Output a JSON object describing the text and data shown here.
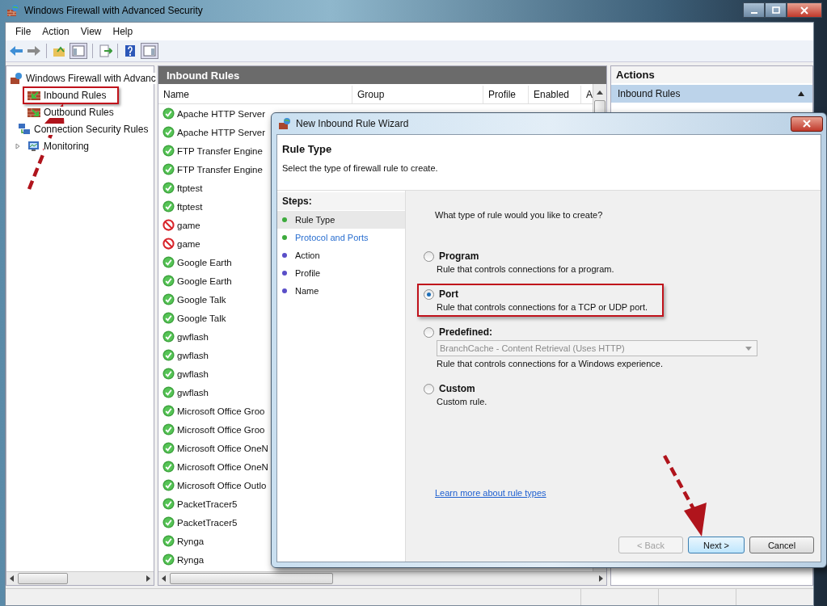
{
  "window": {
    "title": "Windows Firewall with Advanced Security"
  },
  "menu": [
    "File",
    "Action",
    "View",
    "Help"
  ],
  "tree": {
    "root": "Windows Firewall with Advanc",
    "items": [
      {
        "label": "Inbound Rules",
        "kind": "inbound",
        "expandable": false,
        "highlighted": true
      },
      {
        "label": "Outbound Rules",
        "kind": "outbound",
        "expandable": false,
        "highlighted": false
      },
      {
        "label": "Connection Security Rules",
        "kind": "security",
        "expandable": false,
        "highlighted": false
      },
      {
        "label": "Monitoring",
        "kind": "monitor",
        "expandable": true,
        "highlighted": false
      }
    ]
  },
  "rules": {
    "title": "Inbound Rules",
    "columns": [
      "Name",
      "Group",
      "Profile",
      "Enabled",
      "A"
    ],
    "rows": [
      {
        "name": "Apache HTTP Server",
        "kind": "allow"
      },
      {
        "name": "Apache HTTP Server",
        "kind": "allow"
      },
      {
        "name": "FTP Transfer Engine",
        "kind": "allow"
      },
      {
        "name": "FTP Transfer Engine",
        "kind": "allow"
      },
      {
        "name": "ftptest",
        "kind": "allow"
      },
      {
        "name": "ftptest",
        "kind": "allow"
      },
      {
        "name": "game",
        "kind": "block"
      },
      {
        "name": "game",
        "kind": "block"
      },
      {
        "name": "Google Earth",
        "kind": "allow"
      },
      {
        "name": "Google Earth",
        "kind": "allow"
      },
      {
        "name": "Google Talk",
        "kind": "allow"
      },
      {
        "name": "Google Talk",
        "kind": "allow"
      },
      {
        "name": "gwflash",
        "kind": "allow"
      },
      {
        "name": "gwflash",
        "kind": "allow"
      },
      {
        "name": "gwflash",
        "kind": "allow"
      },
      {
        "name": "gwflash",
        "kind": "allow"
      },
      {
        "name": "Microsoft Office Groo",
        "kind": "allow"
      },
      {
        "name": "Microsoft Office Groo",
        "kind": "allow"
      },
      {
        "name": "Microsoft Office OneN",
        "kind": "allow"
      },
      {
        "name": "Microsoft Office OneN",
        "kind": "allow"
      },
      {
        "name": "Microsoft Office Outlo",
        "kind": "allow"
      },
      {
        "name": "PacketTracer5",
        "kind": "allow"
      },
      {
        "name": "PacketTracer5",
        "kind": "allow"
      },
      {
        "name": "Rynga",
        "kind": "allow"
      },
      {
        "name": "Rynga",
        "kind": "allow"
      }
    ]
  },
  "actions": {
    "title": "Actions",
    "section": {
      "label": "Inbound Rules",
      "expanded": true
    }
  },
  "dialog": {
    "title": "New Inbound Rule Wizard",
    "heading": "Rule Type",
    "subtitle": "Select the type of firewall rule to create.",
    "steps_title": "Steps:",
    "steps": [
      {
        "label": "Rule Type",
        "selected": true,
        "link": false,
        "color": "#3caa3c"
      },
      {
        "label": "Protocol and Ports",
        "selected": false,
        "link": true,
        "color": "#3caa3c"
      },
      {
        "label": "Action",
        "selected": false,
        "link": false,
        "color": "#5a4fc8"
      },
      {
        "label": "Profile",
        "selected": false,
        "link": false,
        "color": "#5a4fc8"
      },
      {
        "label": "Name",
        "selected": false,
        "link": false,
        "color": "#5a4fc8"
      }
    ],
    "question": "What type of rule would you like to create?",
    "options": [
      {
        "label": "Program",
        "description": "Rule that controls connections for a program.",
        "selected": false,
        "highlighted": false
      },
      {
        "label": "Port",
        "description": "Rule that controls connections for a TCP or UDP port.",
        "selected": true,
        "highlighted": true
      },
      {
        "label": "Predefined:",
        "description": "Rule that controls connections for a Windows experience.",
        "selected": false,
        "highlighted": false,
        "dropdown": {
          "value": "BranchCache - Content Retrieval (Uses HTTP)",
          "disabled": true
        }
      },
      {
        "label": "Custom",
        "description": "Custom rule.",
        "selected": false,
        "highlighted": false
      }
    ],
    "link": "Learn more about rule types",
    "buttons": [
      {
        "label": "< Back",
        "disabled": true,
        "default": false
      },
      {
        "label": "Next >",
        "disabled": false,
        "default": true
      },
      {
        "label": "Cancel",
        "disabled": false,
        "default": false
      }
    ]
  }
}
